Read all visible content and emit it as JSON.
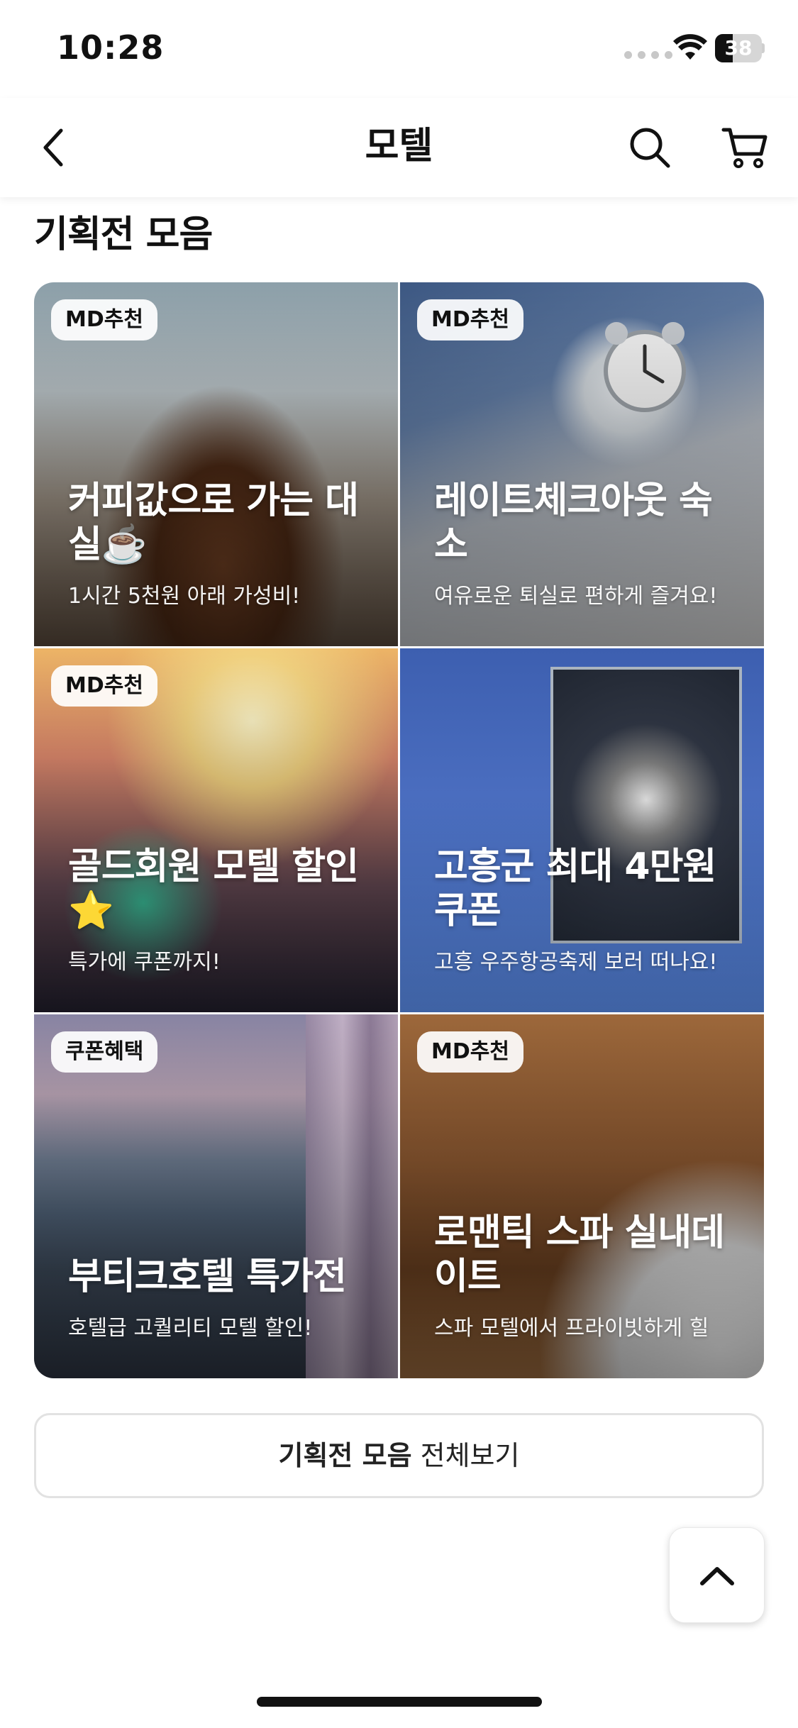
{
  "status_bar": {
    "time": "10:28",
    "battery_level": "38",
    "battery_fraction": 0.38,
    "icons": [
      "cellular-icon",
      "wifi-icon",
      "battery-icon"
    ]
  },
  "nav": {
    "title": "모텔",
    "icons": [
      "back-chevron-icon",
      "search-icon",
      "cart-icon"
    ]
  },
  "section": {
    "title": "기획전 모음"
  },
  "cards": [
    {
      "badge": "MD추천",
      "title": "커피값으로 가는 대실☕️",
      "subtitle": "1시간 5천원 아래 가성비!"
    },
    {
      "badge": "MD추천",
      "title": "레이트체크아웃 숙소",
      "subtitle": "여유로운 퇴실로 편하게 즐겨요!"
    },
    {
      "badge": "MD추천",
      "title": "골드회원 모텔 할인⭐️",
      "subtitle": "특가에 쿠폰까지!"
    },
    {
      "badge": "",
      "title": "고흥군 최대 4만원 쿠폰",
      "subtitle": "고흥 우주항공축제 보러 떠나요!"
    },
    {
      "badge": "쿠폰혜택",
      "title": "부티크호텔 특가전",
      "subtitle": "호텔급 고퀄리티 모텔 할인!"
    },
    {
      "badge": "MD추천",
      "title": "로맨틱 스파 실내데이트",
      "subtitle": "스파 모텔에서 프라이빗하게 힐"
    }
  ],
  "view_all": {
    "strong": "기획전 모음",
    "rest": " 전체보기"
  },
  "scroll_top": {
    "icon": "chevron-up-icon"
  },
  "colors": {
    "accent_text": "#111111",
    "badge_bg": "#ffffff",
    "border": "#e2e2e2"
  }
}
